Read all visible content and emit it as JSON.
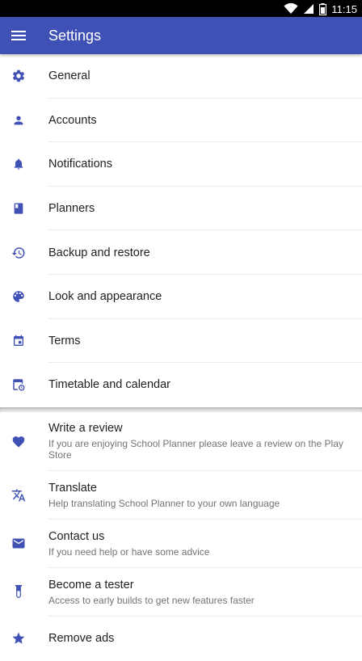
{
  "status_bar": {
    "time": "11:15"
  },
  "toolbar": {
    "title": "Settings",
    "menu_icon": "menu-icon",
    "color": "#3f51b5"
  },
  "settings": [
    {
      "label": "General",
      "icon": "gear-icon"
    },
    {
      "label": "Accounts",
      "icon": "person-icon"
    },
    {
      "label": "Notifications",
      "icon": "bell-icon"
    },
    {
      "label": "Planners",
      "icon": "book-icon"
    },
    {
      "label": "Backup and restore",
      "icon": "restore-icon"
    },
    {
      "label": "Look and appearance",
      "icon": "palette-icon"
    },
    {
      "label": "Terms",
      "icon": "calendar-icon"
    },
    {
      "label": "Timetable and calendar",
      "icon": "schedule-icon"
    }
  ],
  "extras": [
    {
      "title": "Write a review",
      "subtitle": "If you are enjoying School Planner please leave a review on the Play Store",
      "icon": "heart-icon"
    },
    {
      "title": "Translate",
      "subtitle": "Help translating School Planner to your own language",
      "icon": "translate-icon"
    },
    {
      "title": "Contact us",
      "subtitle": "If you need help or have some advice",
      "icon": "mail-icon"
    },
    {
      "title": "Become a tester",
      "subtitle": "Access to early builds to get new features faster",
      "icon": "flask-icon"
    },
    {
      "title": "Remove ads",
      "icon": "star-icon"
    }
  ],
  "icon_color": "#3f51b5"
}
